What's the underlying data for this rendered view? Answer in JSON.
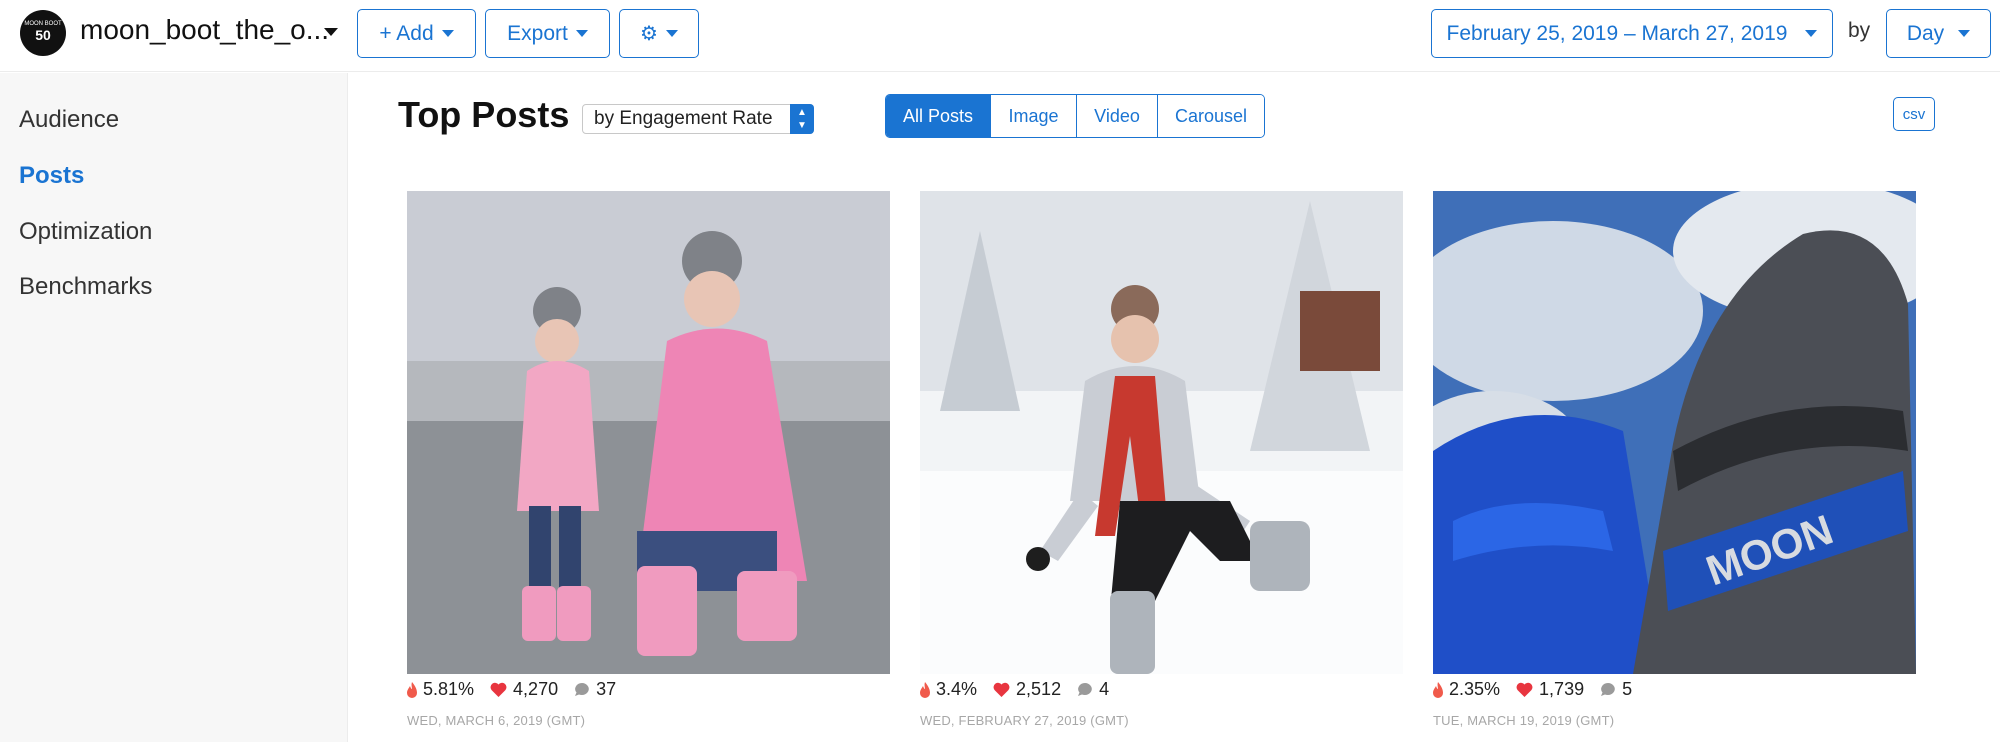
{
  "header": {
    "account_name": "moon_boot_the_o...",
    "logo_text_small": "MOON BOOT",
    "logo_text_big": "50",
    "add_label": "+ Add",
    "export_label": "Export",
    "date_range": "February 25, 2019 – March 27, 2019",
    "by_label": "by",
    "interval": "Day"
  },
  "sidebar": {
    "items": [
      {
        "label": "Audience"
      },
      {
        "label": "Posts"
      },
      {
        "label": "Optimization"
      },
      {
        "label": "Benchmarks"
      }
    ],
    "active": "Posts"
  },
  "main": {
    "title": "Top Posts",
    "sort_select": "by Engagement Rate",
    "filters": [
      "All Posts",
      "Image",
      "Video",
      "Carousel"
    ],
    "active_filter": "All Posts",
    "csv_label": "csv"
  },
  "posts": [
    {
      "engagement_rate": "5.81%",
      "likes": "4,270",
      "comments": "37",
      "date": "WED, MARCH 6, 2019 (GMT)"
    },
    {
      "engagement_rate": "3.4%",
      "likes": "2,512",
      "comments": "4",
      "date": "WED, FEBRUARY 27, 2019 (GMT)"
    },
    {
      "engagement_rate": "2.35%",
      "likes": "1,739",
      "comments": "5",
      "date": "TUE, MARCH 19, 2019 (GMT)"
    }
  ],
  "colors": {
    "accent": "#1a74d2",
    "flame": "#f05a4b",
    "heart": "#e8353f",
    "comment": "#9a9a9a",
    "date_text": "#a7a7a7"
  }
}
